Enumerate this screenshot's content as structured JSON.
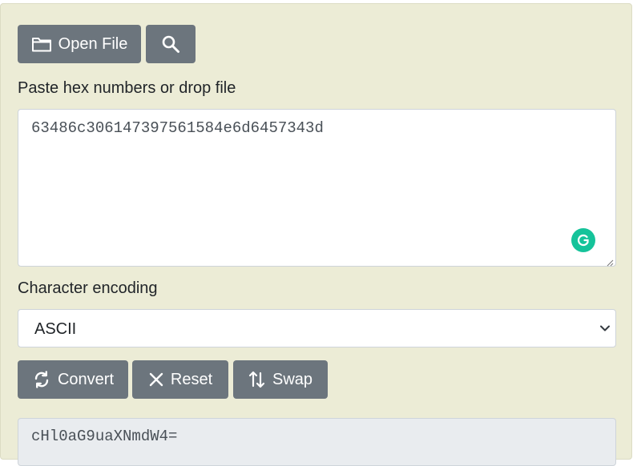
{
  "toolbar": {
    "open_file_label": "Open File",
    "open_file_icon": "folder-icon",
    "search_icon": "search-icon"
  },
  "input_section": {
    "label": "Paste hex numbers or drop file",
    "value": "63486c306147397561584e6d6457343d",
    "assist_icon": "grammarly-icon"
  },
  "encoding": {
    "label": "Character encoding",
    "selected": "ASCII"
  },
  "actions": {
    "convert_label": "Convert",
    "reset_label": "Reset",
    "swap_label": "Swap"
  },
  "output": {
    "value": "cHl0aG9uaXNmdW4="
  },
  "colors": {
    "panel_bg": "#ececd6",
    "button_bg": "#6c757d",
    "grammarly": "#15c39a",
    "output_bg": "#e9ecef"
  }
}
